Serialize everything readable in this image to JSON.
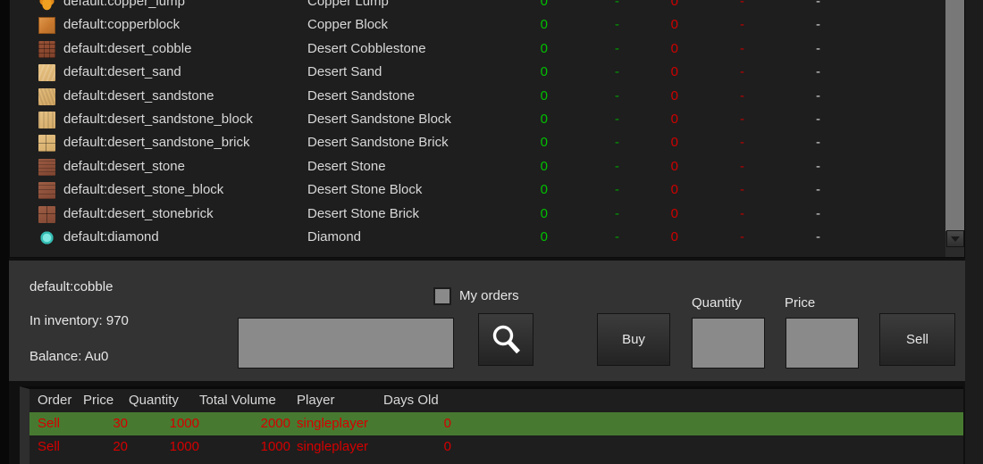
{
  "item_list": {
    "columns": [
      "icon",
      "item_id",
      "item_name",
      "buy_volume",
      "buy_price",
      "sell_volume",
      "sell_price",
      "last_price"
    ],
    "rows": [
      {
        "icon": "copper_lump",
        "id": "default:copper_lump",
        "name": "Copper Lump",
        "c1": "0",
        "c2": "-",
        "c3": "0",
        "c4": "-",
        "c5": "-"
      },
      {
        "icon": "copperblock",
        "id": "default:copperblock",
        "name": "Copper Block",
        "c1": "0",
        "c2": "-",
        "c3": "0",
        "c4": "-",
        "c5": "-"
      },
      {
        "icon": "desert_cobble",
        "id": "default:desert_cobble",
        "name": "Desert Cobblestone",
        "c1": "0",
        "c2": "-",
        "c3": "0",
        "c4": "-",
        "c5": "-"
      },
      {
        "icon": "desert_sand",
        "id": "default:desert_sand",
        "name": "Desert Sand",
        "c1": "0",
        "c2": "-",
        "c3": "0",
        "c4": "-",
        "c5": "-"
      },
      {
        "icon": "desert_sandstone",
        "id": "default:desert_sandstone",
        "name": "Desert Sandstone",
        "c1": "0",
        "c2": "-",
        "c3": "0",
        "c4": "-",
        "c5": "-"
      },
      {
        "icon": "desert_sandstone_block",
        "id": "default:desert_sandstone_block",
        "name": "Desert Sandstone Block",
        "c1": "0",
        "c2": "-",
        "c3": "0",
        "c4": "-",
        "c5": "-"
      },
      {
        "icon": "desert_sandstone_brick",
        "id": "default:desert_sandstone_brick",
        "name": "Desert Sandstone Brick",
        "c1": "0",
        "c2": "-",
        "c3": "0",
        "c4": "-",
        "c5": "-"
      },
      {
        "icon": "desert_stone",
        "id": "default:desert_stone",
        "name": "Desert Stone",
        "c1": "0",
        "c2": "-",
        "c3": "0",
        "c4": "-",
        "c5": "-"
      },
      {
        "icon": "desert_stone_block",
        "id": "default:desert_stone_block",
        "name": "Desert Stone Block",
        "c1": "0",
        "c2": "-",
        "c3": "0",
        "c4": "-",
        "c5": "-"
      },
      {
        "icon": "desert_stonebrick",
        "id": "default:desert_stonebrick",
        "name": "Desert Stone Brick",
        "c1": "0",
        "c2": "-",
        "c3": "0",
        "c4": "-",
        "c5": "-"
      },
      {
        "icon": "diamond",
        "id": "default:diamond",
        "name": "Diamond",
        "c1": "0",
        "c2": "-",
        "c3": "0",
        "c4": "-",
        "c5": "-"
      }
    ]
  },
  "controls": {
    "selected_item_id": "default:cobble",
    "inventory_text": "In inventory: 970",
    "balance_text": "Balance: Au0",
    "my_orders_label": "My orders",
    "search_value": "",
    "search_placeholder": "",
    "search_icon": "magnifier-icon",
    "buy_label": "Buy",
    "sell_label": "Sell",
    "quantity_label": "Quantity",
    "price_label": "Price",
    "quantity_value": "",
    "price_value": ""
  },
  "orders": {
    "headers": {
      "order": "Order",
      "price": "Price",
      "quantity": "Quantity",
      "total_volume": "Total Volume",
      "player": "Player",
      "days_old": "Days Old"
    },
    "rows": [
      {
        "order": "Sell",
        "price": "30",
        "quantity": "1000",
        "total_volume": "2000",
        "player": "singleplayer",
        "days_old": "0",
        "highlight": true
      },
      {
        "order": "Sell",
        "price": "20",
        "quantity": "1000",
        "total_volume": "1000",
        "player": "singleplayer",
        "days_old": "0",
        "highlight": false
      }
    ]
  },
  "colors": {
    "panel_bg": "#1e1e1e",
    "control_bg": "#333333",
    "highlight_green": "#477a30",
    "order_red": "#d40000",
    "buy_green": "#00c000",
    "sell_red": "#d00000",
    "input_gray": "#8a8a8a"
  }
}
